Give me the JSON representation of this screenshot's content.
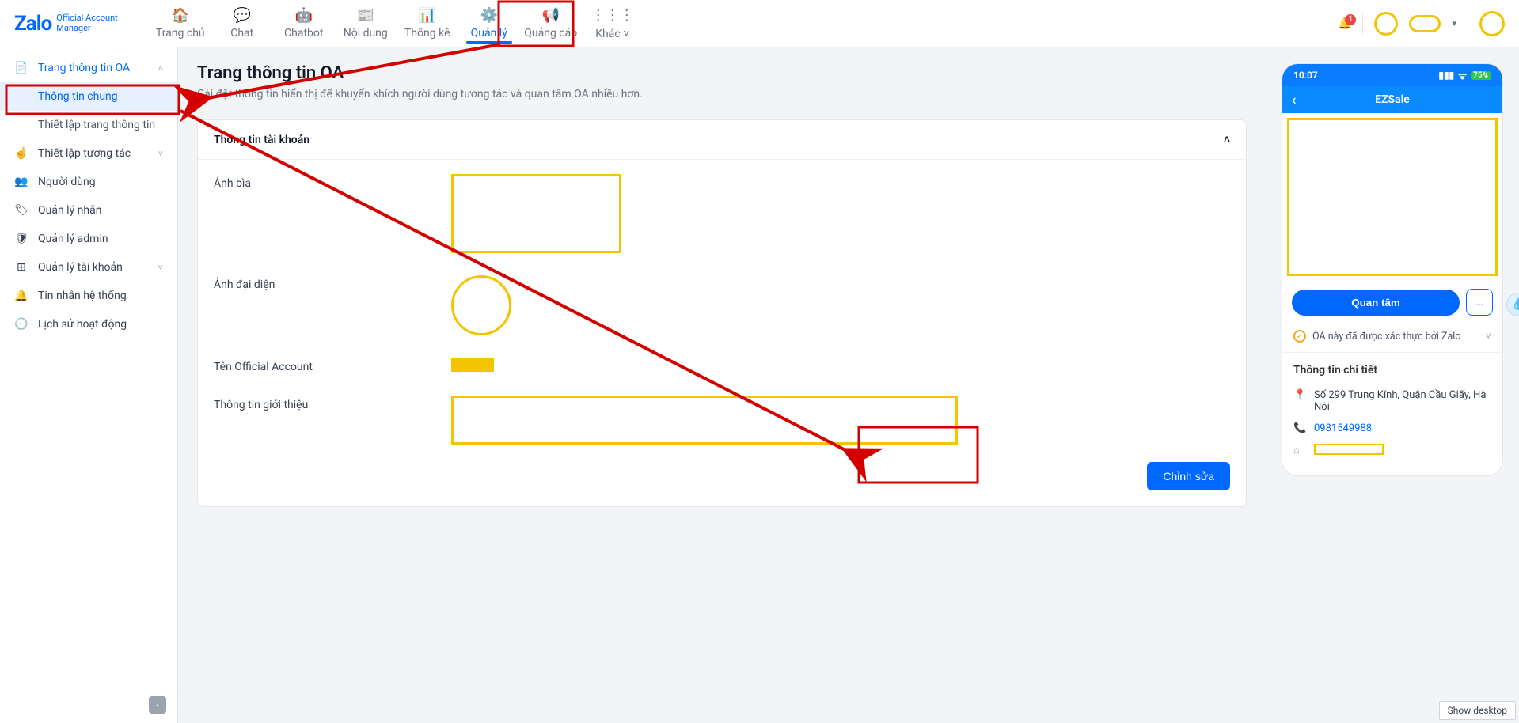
{
  "logo": {
    "brand": "Zalo",
    "line1": "Official Account",
    "line2": "Manager"
  },
  "topnav": [
    {
      "icon": "🏠",
      "label": "Trang chủ"
    },
    {
      "icon": "💬",
      "label": "Chat"
    },
    {
      "icon": "🤖",
      "label": "Chatbot"
    },
    {
      "icon": "📰",
      "label": "Nội dung"
    },
    {
      "icon": "📊",
      "label": "Thống kê"
    },
    {
      "icon": "⚙️",
      "label": "Quản lý"
    },
    {
      "icon": "📢",
      "label": "Quảng cáo"
    },
    {
      "icon": "⋮⋮⋮",
      "label": "Khác ˅"
    }
  ],
  "bell_count": "1",
  "sidebar": {
    "top": {
      "label": "Trang thông tin OA"
    },
    "subs": [
      {
        "label": "Thông tin chung"
      },
      {
        "label": "Thiết lập trang thông tin"
      }
    ],
    "items": [
      {
        "icon": "☝",
        "label": "Thiết lập tương tác",
        "expandable": true
      },
      {
        "icon": "👥",
        "label": "Người dùng"
      },
      {
        "icon": "🏷",
        "label": "Quản lý nhãn"
      },
      {
        "icon": "🛡",
        "label": "Quản lý admin"
      },
      {
        "icon": "⊞",
        "label": "Quản lý tài khoản",
        "expandable": true
      },
      {
        "icon": "🔔",
        "label": "Tin nhắn hệ thống"
      },
      {
        "icon": "🕘",
        "label": "Lịch sử hoạt động"
      }
    ]
  },
  "page": {
    "title": "Trang thông tin OA",
    "subtitle": "Cài đặt thông tin hiển thị để khuyến khích người dùng tương tác và quan tâm OA nhiều hơn."
  },
  "card": {
    "title": "Thông tin tài khoản",
    "rows": {
      "cover": "Ảnh bìa",
      "avatar": "Ảnh đại diện",
      "name": "Tên Official Account",
      "desc": "Thông tin giới thiệu"
    },
    "edit": "Chỉnh sửa"
  },
  "preview": {
    "time": "10:07",
    "battery": "75",
    "title": "EZSale",
    "follow": "Quan tâm",
    "more": "…",
    "verified": "OA này đã được xác thực bởi Zalo",
    "detail_title": "Thông tin chi tiết",
    "address": "Số 299 Trung Kính, Quận Cầu Giấy, Hà Nội",
    "phone": "0981549988"
  },
  "show_desktop": "Show desktop"
}
